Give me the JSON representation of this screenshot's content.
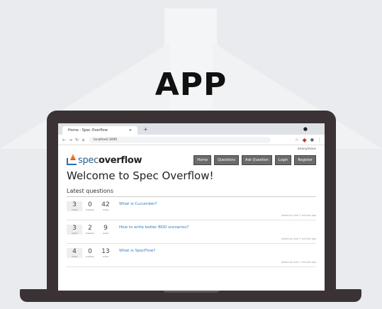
{
  "headline": "APP",
  "browser": {
    "tab_title": "Home - Spec Overflow",
    "tab_close": "×",
    "new_tab": "+",
    "url": "localhost:3000",
    "nav_icons": [
      "back-icon",
      "forward-icon",
      "reload-icon",
      "home-icon"
    ]
  },
  "site": {
    "topright_link": "anonymous",
    "logo_spec": "spec",
    "logo_overflow": "overflow",
    "nav": [
      "Home",
      "Questions",
      "Ask Question",
      "Login",
      "Register"
    ],
    "page_title": "Welcome to Spec Overflow!",
    "section_title": "Latest questions"
  },
  "questions": [
    {
      "votes": "3",
      "answers": "0",
      "views": "42",
      "votes_label": "votes",
      "answers_label": "answers",
      "views_label": "views",
      "title": "What is Cucumber?",
      "meta": "asked by user 1 minute ago"
    },
    {
      "votes": "3",
      "answers": "2",
      "views": "9",
      "votes_label": "votes",
      "answers_label": "answers",
      "views_label": "views",
      "title": "How to write better BDD scenarios?",
      "meta": "asked by user 1 minute ago"
    },
    {
      "votes": "4",
      "answers": "0",
      "views": "13",
      "votes_label": "votes",
      "answers_label": "answers",
      "views_label": "views",
      "title": "What is SpecFlow?",
      "meta": "asked by user 1 minute ago"
    }
  ],
  "colors": {
    "laptop": "#3a3235",
    "link": "#2f7bbf",
    "nav_button": "#6b6b6b"
  }
}
